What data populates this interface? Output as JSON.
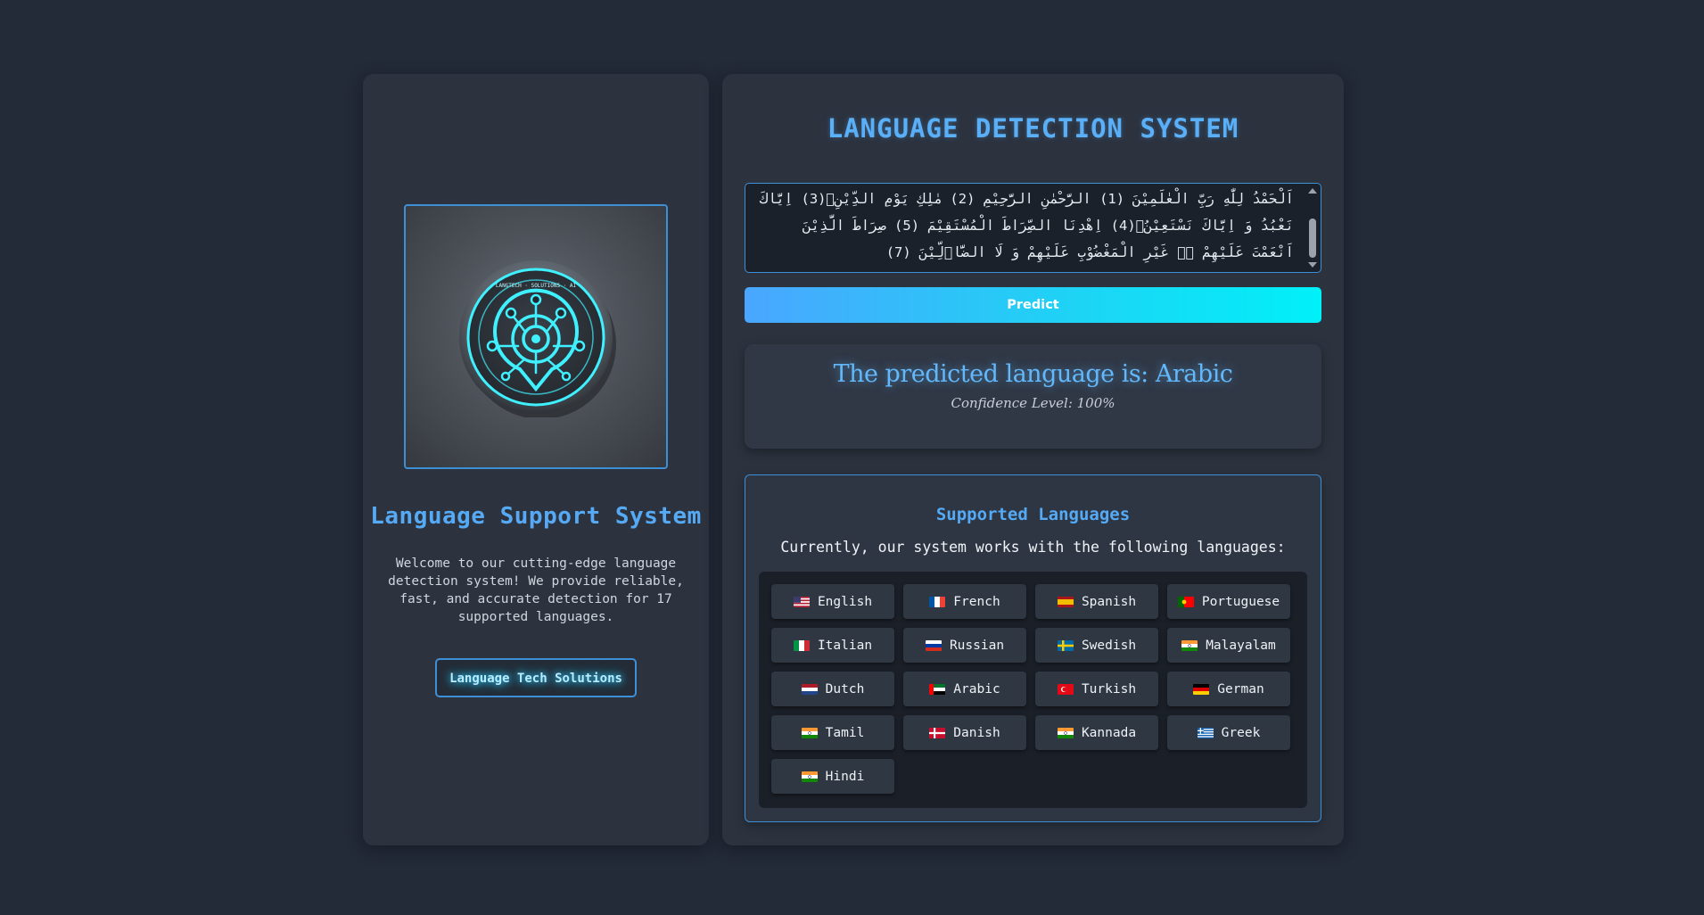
{
  "left_panel": {
    "title": "Language Support System",
    "description": "Welcome to our cutting-edge language detection system! We provide reliable, fast, and accurate detection for 17 supported languages.",
    "company_button": "Language Tech Solutions",
    "logo_icon": "circuit-speech-bubble-icon",
    "logo_ring_text": "LANGTECH · SOLUTIONS · AI"
  },
  "main": {
    "title": "LANGUAGE DETECTION SYSTEM",
    "input_text": "اَلْحَمْدُ لِلّٰهِ رَبِّ الْعٰلَمِيْنَ (1) الرَّحْمٰنِ الرَّحِيْمِ (2) مٰلِكِ يَوْمِ الدِّيْنِۗ(3) اِيَّاكَ نَعْبُدُ وَ اِيَّاكَ نَسْتَعِيْنُۗ(4) اِهْدِنَا الصِّرَاطَ الْمُسْتَقِيْمَ (5) صِرَاطَ الَّذِيْنَ اَنْعَمْتَ عَلَيْهِمْ ەۙ غَيْرِ الْمَغْضُوْبِ عَلَيْهِمْ وَ لَا الضَّاۤلِّيْنَ (7)",
    "predict_label": "Predict",
    "result_text": "The predicted language is: Arabic",
    "confidence_text": "Confidence Level: 100%"
  },
  "supported": {
    "title": "Supported Languages",
    "subtitle": "Currently, our system works with the following languages:",
    "languages": [
      {
        "name": "English",
        "flag": "us"
      },
      {
        "name": "French",
        "flag": "fr"
      },
      {
        "name": "Spanish",
        "flag": "es"
      },
      {
        "name": "Portuguese",
        "flag": "pt"
      },
      {
        "name": "Italian",
        "flag": "it"
      },
      {
        "name": "Russian",
        "flag": "ru"
      },
      {
        "name": "Swedish",
        "flag": "se"
      },
      {
        "name": "Malayalam",
        "flag": "in"
      },
      {
        "name": "Dutch",
        "flag": "nl"
      },
      {
        "name": "Arabic",
        "flag": "ae"
      },
      {
        "name": "Turkish",
        "flag": "tr"
      },
      {
        "name": "German",
        "flag": "de"
      },
      {
        "name": "Tamil",
        "flag": "in"
      },
      {
        "name": "Danish",
        "flag": "dk"
      },
      {
        "name": "Kannada",
        "flag": "in"
      },
      {
        "name": "Greek",
        "flag": "gr"
      },
      {
        "name": "Hindi",
        "flag": "in"
      }
    ]
  },
  "colors": {
    "background": "#232a38",
    "panel": "#2c333f",
    "accent_blue": "#56aaf5",
    "accent_cyan": "#00f0f8",
    "border_blue": "#3d8fd6"
  }
}
